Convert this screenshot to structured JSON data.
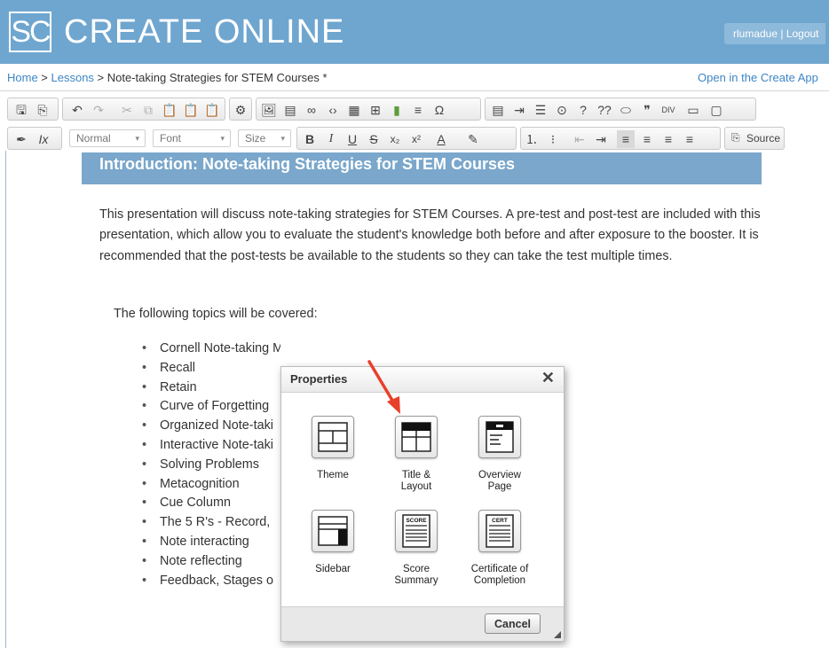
{
  "header": {
    "logo_text": "SC",
    "brand": "CREATE ONLINE",
    "user": "rlumadue | Logout"
  },
  "breadcrumb": {
    "home": "Home",
    "sep1": " > ",
    "lessons": "Lessons",
    "sep2": " > ",
    "current": "Note-taking Strategies for STEM Courses *",
    "open_app": "Open in the Create App"
  },
  "toolbar": {
    "style_value": "Normal",
    "font_value": "Font",
    "size_value": "Size",
    "source_label": "Source"
  },
  "document": {
    "banner": "Introduction: Note-taking Strategies for STEM Courses",
    "paragraph": "This presentation will discuss note-taking strategies for STEM Courses.  A pre-test and post-test are included with this presentation, which allow you to evaluate the student's knowledge both before and after exposure to the booster. It is recommended that the post-tests be available to the students so they can take the test multiple times.",
    "following": "The following topics will be covered:",
    "topics": [
      "Cornell Note-taking Method",
      "Recall",
      "Retain",
      "Curve of Forgetting",
      "Organized Note-taki",
      "Interactive Note-taki",
      "Solving Problems",
      "Metacognition",
      "Cue Column",
      "The 5 R's - Record,",
      "Note interacting",
      "Note reflecting",
      "Feedback, Stages o"
    ]
  },
  "dialog": {
    "title": "Properties",
    "close": "✕",
    "options": [
      {
        "line1": "Theme",
        "line2": ""
      },
      {
        "line1": "Title &",
        "line2": "Layout"
      },
      {
        "line1": "Overview",
        "line2": "Page"
      },
      {
        "line1": "Sidebar",
        "line2": ""
      },
      {
        "line1": "Score",
        "line2": "Summary",
        "badge": "SCORE"
      },
      {
        "line1": "Certificate of",
        "line2": "Completion",
        "badge": "CERT"
      }
    ],
    "cancel": "Cancel"
  },
  "colors": {
    "header_bg": "#6fa6cf",
    "banner_bg": "#7aa7cb",
    "link": "#3d86c6",
    "annotation_arrow": "#e8402a"
  }
}
